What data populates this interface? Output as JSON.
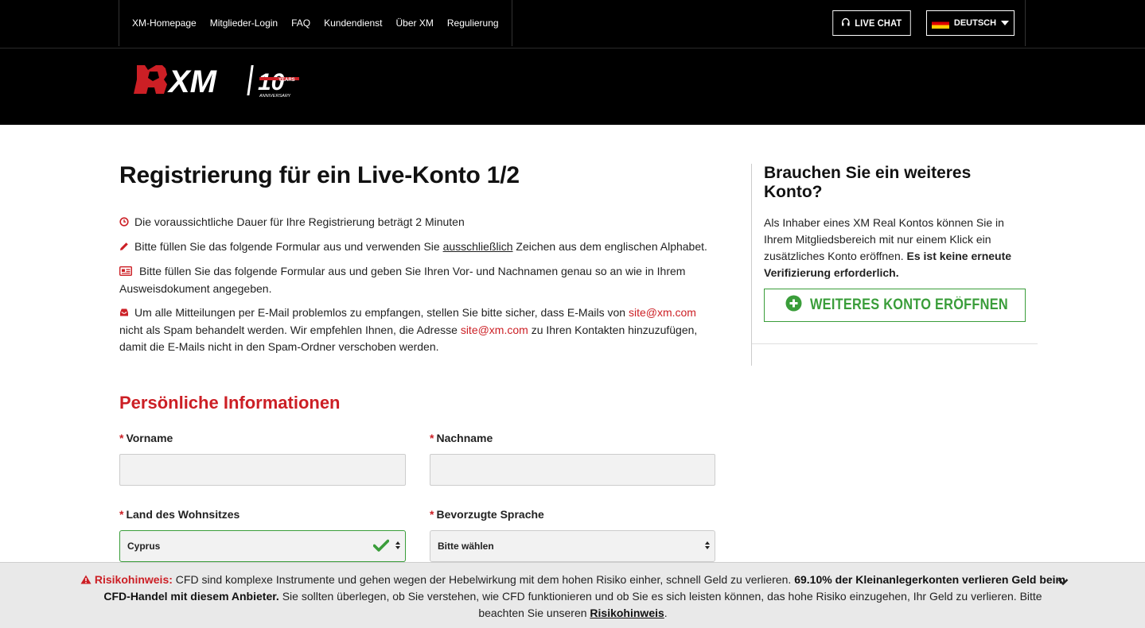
{
  "topnav": {
    "links": [
      "XM-Homepage",
      "Mitglieder-Login",
      "FAQ",
      "Kundendienst",
      "Über XM",
      "Regulierung"
    ],
    "live_chat": "LIVE CHAT",
    "language": "DEUTSCH"
  },
  "logo": {
    "brand": "XM",
    "years": "10",
    "years_word": "YEARS",
    "anniversary": "ANNIVERSARY"
  },
  "main": {
    "title": "Registrierung für ein Live-Konto 1/2",
    "info1": "Die voraussichtliche Dauer für Ihre Registrierung beträgt 2 Minuten",
    "info2_pre": "Bitte füllen Sie das folgende Formular aus und verwenden Sie ",
    "info2_u": "ausschließlich",
    "info2_post": " Zeichen aus dem englischen Alphabet.",
    "info3": "Bitte füllen Sie das folgende Formular aus und geben Sie Ihren Vor- und Nachnamen genau so an wie in Ihrem Ausweisdokument angegeben.",
    "info4_a": "Um alle Mitteilungen per E-Mail problemlos zu empfangen, stellen Sie bitte sicher, dass E-Mails von ",
    "info4_email1": "site@xm.com",
    "info4_b": " nicht als Spam behandelt werden. Wir empfehlen Ihnen, die Adresse ",
    "info4_email2": "site@xm.com",
    "info4_c": " zu Ihren Kontakten hinzuzufügen, damit die E-Mails nicht in den Spam-Ordner verschoben werden."
  },
  "form": {
    "section": "Persönliche Informationen",
    "required_mark": "*",
    "first_name_label": "Vorname",
    "first_name_value": "",
    "last_name_label": "Nachname",
    "last_name_value": "",
    "country_label": "Land des Wohnsitzes",
    "country_value": "Cyprus",
    "language_label": "Bevorzugte Sprache",
    "language_value": "Bitte wählen"
  },
  "sidebar": {
    "title": "Brauchen Sie ein weiteres Konto?",
    "text": "Als Inhaber eines XM Real Kontos können Sie in Ihrem Mitgliedsbereich mit nur einem Klick ein zusätzliches Konto eröffnen. ",
    "text_bold": "Es ist keine erneute Verifizierung erforderlich.",
    "button": "WEITERES KONTO ERÖFFNEN"
  },
  "risk": {
    "label": "Risikohinweis:",
    "text1": " CFD sind komplexe Instrumente und gehen wegen der Hebelwirkung mit dem hohen Risiko einher, schnell Geld zu verlieren. ",
    "bold": "69.10% der Kleinanlegerkonten verlieren Geld beim CFD-Handel mit diesem Anbieter.",
    "text2": " Sie sollten überlegen, ob Sie verstehen, wie CFD funktionieren und ob Sie es sich leisten können, das hohe Risiko einzugehen, Ihr Geld zu verlieren. Bitte beachten Sie unseren ",
    "link": "Risikohinweis",
    "end": "."
  },
  "colors": {
    "brand_red": "#cc1f25",
    "success_green": "#3a9d3a",
    "header_bg": "#000000"
  }
}
